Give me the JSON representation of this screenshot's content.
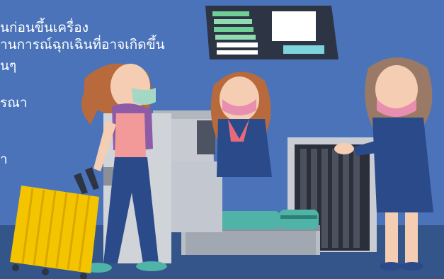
{
  "illustration": {
    "theme": "airport-security-checkpoint",
    "colors": {
      "background": "#4a73ba",
      "floor": "#33558a",
      "board": "#2d3444",
      "board_green": "#6fcf97",
      "board_teal": "#7fd3dc",
      "uniform": "#2b4a8a",
      "mask": "#e88fb0",
      "face_mask_green": "#a5d8c4",
      "suitcase": "#f5c400",
      "machine": "#d0d3d8",
      "luggage_bag": "#4fb3a7",
      "tank_top": "#f29a9a"
    }
  },
  "text_lines": [
    "นก่อนขึ้นเครื่อง",
    "านการณ์ฉุกเฉินที่อาจเกิดขึ้น",
    "นๆ",
    "รณา",
    "่า"
  ]
}
